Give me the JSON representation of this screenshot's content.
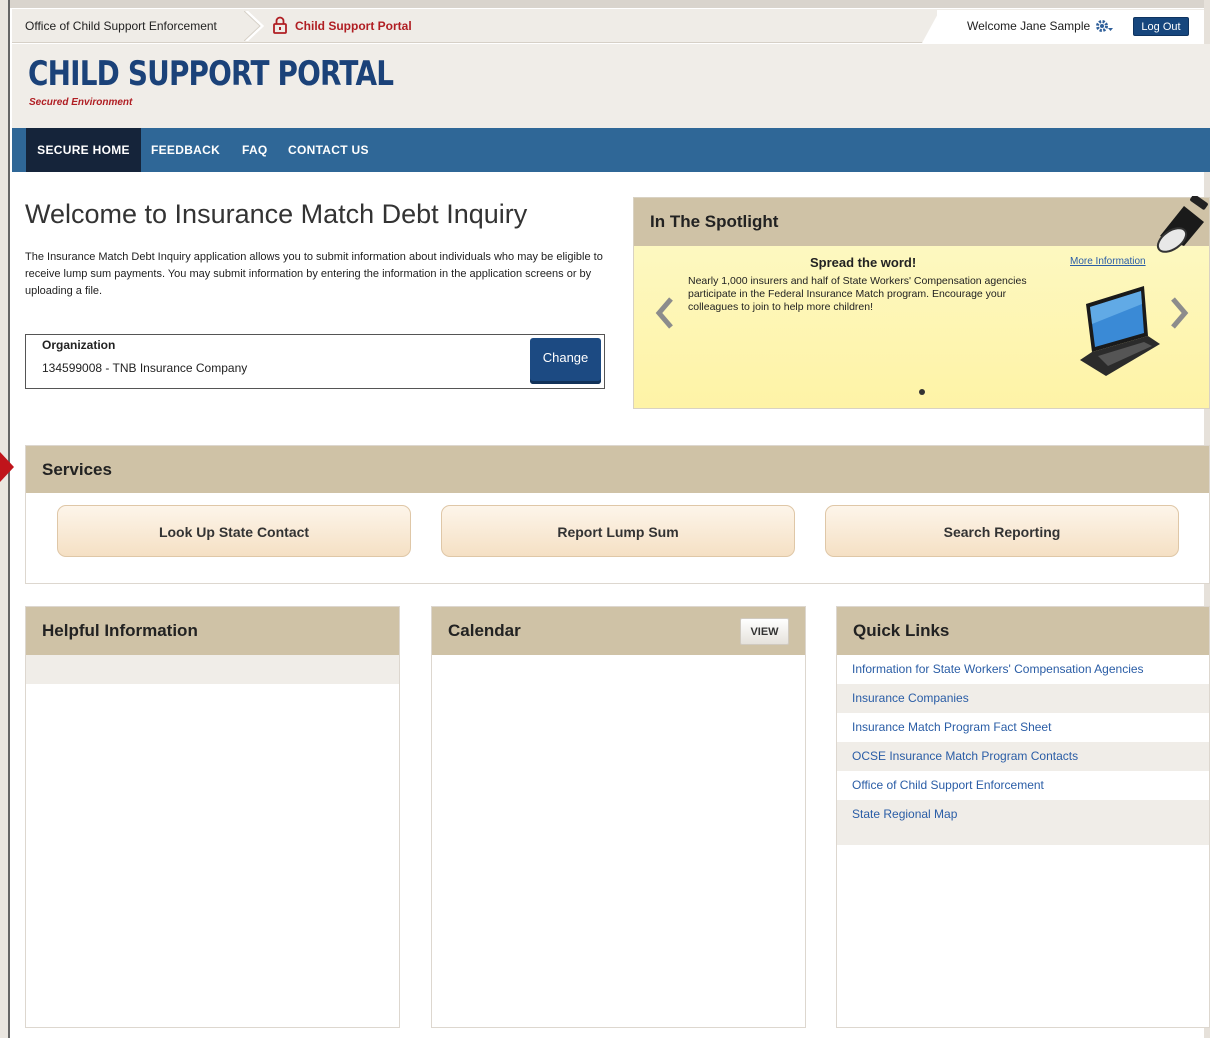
{
  "topbar": {
    "breadcrumb_org": "Office of Child Support Enforcement",
    "breadcrumb_portal": "Child Support Portal",
    "welcome": "Welcome Jane Sample",
    "logout_label": "Log Out",
    "accent_red": "#b01e23",
    "accent_blue": "#16467d"
  },
  "header": {
    "title": "CHILD SUPPORT PORTAL",
    "subtitle": "Secured Environment"
  },
  "nav": {
    "items": [
      {
        "label": "SECURE HOME",
        "active": true
      },
      {
        "label": "FEEDBACK",
        "active": false
      },
      {
        "label": "FAQ",
        "active": false
      },
      {
        "label": "CONTACT US",
        "active": false
      }
    ],
    "bar_color": "#2f6797",
    "active_color": "#15243a"
  },
  "main": {
    "title": "Welcome to Insurance Match Debt Inquiry",
    "description": "The Insurance Match Debt Inquiry application allows you to submit information about individuals who may be eligible to receive lump sum payments. You may submit information by entering the information in the application screens or by uploading a file.",
    "organization": {
      "label": "Organization",
      "value": "134599008 - TNB Insurance Company",
      "change_label": "Change"
    }
  },
  "spotlight": {
    "title": "In The Spotlight",
    "heading": "Spread the word!",
    "more_link": "More Information",
    "text": "Nearly 1,000 insurers and half of State Workers' Compensation agencies participate in the Federal Insurance Match program. Encourage your colleagues to join to help more children!",
    "icons": [
      "spotlight-lamp-icon",
      "laptop-icon",
      "chevron-left-icon",
      "chevron-right-icon"
    ]
  },
  "services": {
    "title": "Services",
    "buttons": [
      "Look Up State Contact",
      "Report Lump Sum",
      "Search Reporting"
    ]
  },
  "panels": {
    "helpful": {
      "title": "Helpful Information"
    },
    "calendar": {
      "title": "Calendar",
      "view_label": "VIEW"
    },
    "quick_links": {
      "title": "Quick Links",
      "links": [
        "Information for State Workers' Compensation Agencies",
        "Insurance Companies",
        "Insurance Match Program Fact Sheet",
        "OCSE Insurance Match Program Contacts",
        "Office of Child Support Enforcement",
        "State Regional Map"
      ]
    }
  }
}
